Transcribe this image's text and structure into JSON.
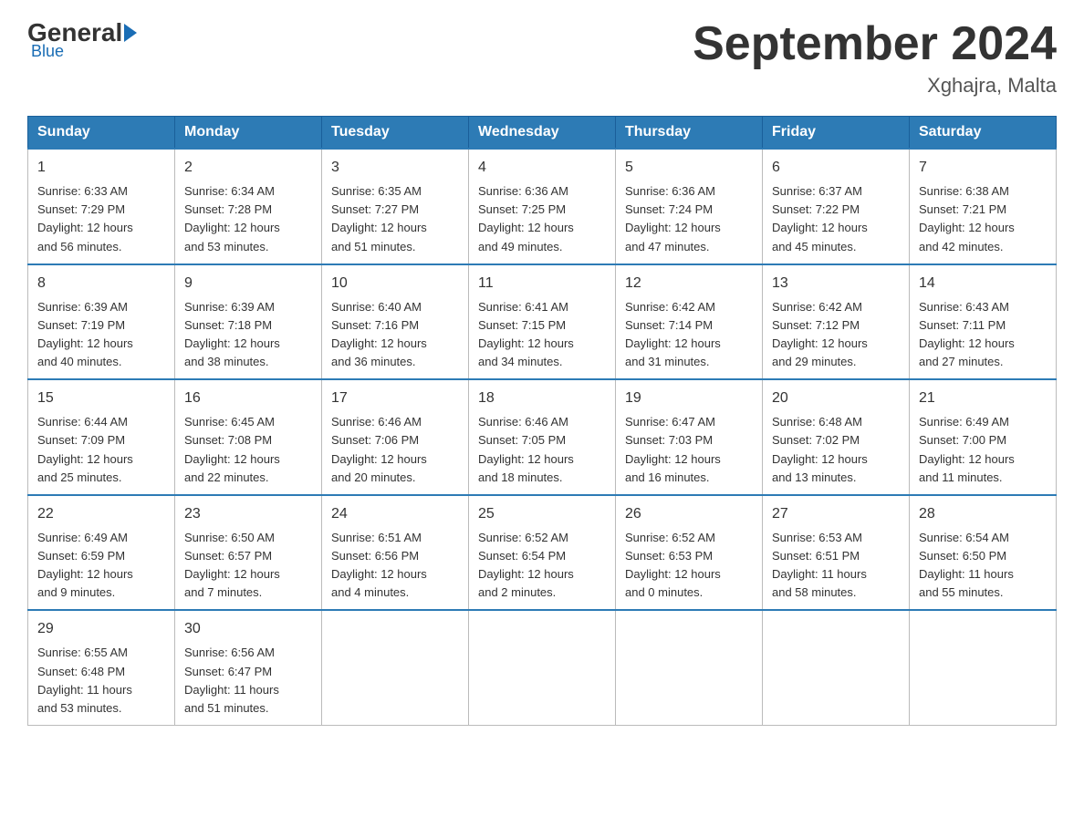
{
  "header": {
    "logo": {
      "general": "General",
      "blue": "Blue"
    },
    "title": "September 2024",
    "location": "Xghajra, Malta"
  },
  "columns": [
    "Sunday",
    "Monday",
    "Tuesday",
    "Wednesday",
    "Thursday",
    "Friday",
    "Saturday"
  ],
  "weeks": [
    [
      {
        "day": "1",
        "info": "Sunrise: 6:33 AM\nSunset: 7:29 PM\nDaylight: 12 hours\nand 56 minutes."
      },
      {
        "day": "2",
        "info": "Sunrise: 6:34 AM\nSunset: 7:28 PM\nDaylight: 12 hours\nand 53 minutes."
      },
      {
        "day": "3",
        "info": "Sunrise: 6:35 AM\nSunset: 7:27 PM\nDaylight: 12 hours\nand 51 minutes."
      },
      {
        "day": "4",
        "info": "Sunrise: 6:36 AM\nSunset: 7:25 PM\nDaylight: 12 hours\nand 49 minutes."
      },
      {
        "day": "5",
        "info": "Sunrise: 6:36 AM\nSunset: 7:24 PM\nDaylight: 12 hours\nand 47 minutes."
      },
      {
        "day": "6",
        "info": "Sunrise: 6:37 AM\nSunset: 7:22 PM\nDaylight: 12 hours\nand 45 minutes."
      },
      {
        "day": "7",
        "info": "Sunrise: 6:38 AM\nSunset: 7:21 PM\nDaylight: 12 hours\nand 42 minutes."
      }
    ],
    [
      {
        "day": "8",
        "info": "Sunrise: 6:39 AM\nSunset: 7:19 PM\nDaylight: 12 hours\nand 40 minutes."
      },
      {
        "day": "9",
        "info": "Sunrise: 6:39 AM\nSunset: 7:18 PM\nDaylight: 12 hours\nand 38 minutes."
      },
      {
        "day": "10",
        "info": "Sunrise: 6:40 AM\nSunset: 7:16 PM\nDaylight: 12 hours\nand 36 minutes."
      },
      {
        "day": "11",
        "info": "Sunrise: 6:41 AM\nSunset: 7:15 PM\nDaylight: 12 hours\nand 34 minutes."
      },
      {
        "day": "12",
        "info": "Sunrise: 6:42 AM\nSunset: 7:14 PM\nDaylight: 12 hours\nand 31 minutes."
      },
      {
        "day": "13",
        "info": "Sunrise: 6:42 AM\nSunset: 7:12 PM\nDaylight: 12 hours\nand 29 minutes."
      },
      {
        "day": "14",
        "info": "Sunrise: 6:43 AM\nSunset: 7:11 PM\nDaylight: 12 hours\nand 27 minutes."
      }
    ],
    [
      {
        "day": "15",
        "info": "Sunrise: 6:44 AM\nSunset: 7:09 PM\nDaylight: 12 hours\nand 25 minutes."
      },
      {
        "day": "16",
        "info": "Sunrise: 6:45 AM\nSunset: 7:08 PM\nDaylight: 12 hours\nand 22 minutes."
      },
      {
        "day": "17",
        "info": "Sunrise: 6:46 AM\nSunset: 7:06 PM\nDaylight: 12 hours\nand 20 minutes."
      },
      {
        "day": "18",
        "info": "Sunrise: 6:46 AM\nSunset: 7:05 PM\nDaylight: 12 hours\nand 18 minutes."
      },
      {
        "day": "19",
        "info": "Sunrise: 6:47 AM\nSunset: 7:03 PM\nDaylight: 12 hours\nand 16 minutes."
      },
      {
        "day": "20",
        "info": "Sunrise: 6:48 AM\nSunset: 7:02 PM\nDaylight: 12 hours\nand 13 minutes."
      },
      {
        "day": "21",
        "info": "Sunrise: 6:49 AM\nSunset: 7:00 PM\nDaylight: 12 hours\nand 11 minutes."
      }
    ],
    [
      {
        "day": "22",
        "info": "Sunrise: 6:49 AM\nSunset: 6:59 PM\nDaylight: 12 hours\nand 9 minutes."
      },
      {
        "day": "23",
        "info": "Sunrise: 6:50 AM\nSunset: 6:57 PM\nDaylight: 12 hours\nand 7 minutes."
      },
      {
        "day": "24",
        "info": "Sunrise: 6:51 AM\nSunset: 6:56 PM\nDaylight: 12 hours\nand 4 minutes."
      },
      {
        "day": "25",
        "info": "Sunrise: 6:52 AM\nSunset: 6:54 PM\nDaylight: 12 hours\nand 2 minutes."
      },
      {
        "day": "26",
        "info": "Sunrise: 6:52 AM\nSunset: 6:53 PM\nDaylight: 12 hours\nand 0 minutes."
      },
      {
        "day": "27",
        "info": "Sunrise: 6:53 AM\nSunset: 6:51 PM\nDaylight: 11 hours\nand 58 minutes."
      },
      {
        "day": "28",
        "info": "Sunrise: 6:54 AM\nSunset: 6:50 PM\nDaylight: 11 hours\nand 55 minutes."
      }
    ],
    [
      {
        "day": "29",
        "info": "Sunrise: 6:55 AM\nSunset: 6:48 PM\nDaylight: 11 hours\nand 53 minutes."
      },
      {
        "day": "30",
        "info": "Sunrise: 6:56 AM\nSunset: 6:47 PM\nDaylight: 11 hours\nand 51 minutes."
      },
      null,
      null,
      null,
      null,
      null
    ]
  ]
}
